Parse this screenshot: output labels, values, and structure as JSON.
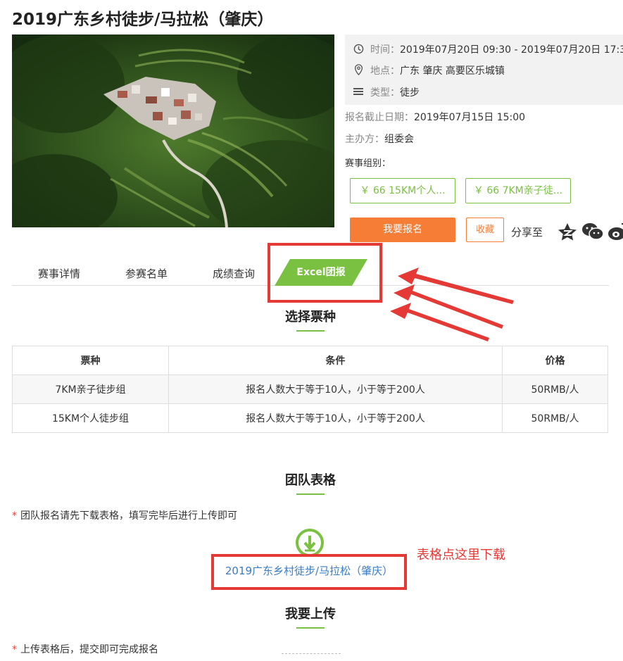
{
  "event": {
    "title": "2019广东乡村徒步/马拉松（肇庆）",
    "time_label": "时间：",
    "time_value": "2019年07月20日 09:30 - 2019年07月20日 17:3",
    "location_label": "地点：",
    "location_value": "广东 肇庆 高要区乐城镇",
    "type_label": "类型：",
    "type_value": "徒步",
    "deadline_label": "报名截止日期：",
    "deadline_value": "2019年07月15日 15:00",
    "organizer_label": "主办方：",
    "organizer_value": "组委会",
    "groups_label": "赛事组别："
  },
  "groups": [
    {
      "label": "￥ 66 15KM个人..."
    },
    {
      "label": "￥ 66 7KM亲子徒..."
    }
  ],
  "actions": {
    "signup": "我要报名",
    "favorite": "收藏",
    "share": "分享至"
  },
  "tabs": {
    "details": "赛事详情",
    "roster": "参赛名单",
    "results": "成绩查询",
    "excel": "Excel团报"
  },
  "ticket_section": {
    "title": "选择票种",
    "headers": [
      "票种",
      "条件",
      "价格"
    ],
    "rows": [
      [
        "7KM亲子徒步组",
        "报名人数大于等于10人，小于等于200人",
        "50RMB/人"
      ],
      [
        "15KM个人徒步组",
        "报名人数大于等于10人，小于等于200人",
        "50RMB/人"
      ]
    ]
  },
  "team_section": {
    "title": "团队表格",
    "note": "团队报名请先下载表格，填写完毕后进行上传即可",
    "download_link": "2019广东乡村徒步/马拉松（肇庆）"
  },
  "upload_section": {
    "title": "我要上传",
    "note": "上传表格后，提交即可完成报名"
  },
  "annotation": {
    "text": "表格点这里下载"
  },
  "colors": {
    "accent_green": "#7ac142",
    "signup_orange": "#f57d36",
    "annotation_red": "#e53935",
    "link_blue": "#3a7cc4"
  }
}
